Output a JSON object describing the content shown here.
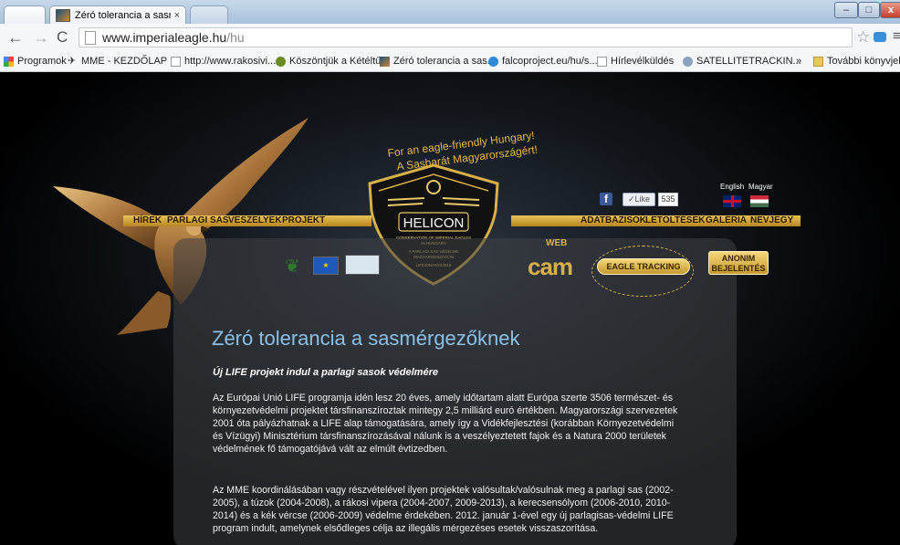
{
  "browser": {
    "tab_title": "Zéró tolerancia a sasmérg",
    "tab_close": "×",
    "url_host": "www.imperialeagle.hu",
    "url_path": "/hu",
    "window_buttons": {
      "minimize": "–",
      "maximize": "□",
      "close": "x"
    },
    "bookmarks": [
      "Programok",
      "MME - KEZDŐLAP",
      "http://www.rakosivi...",
      "Köszöntjük a Kétéltű...",
      "Zéró tolerancia a sas...",
      "falcoproject.eu/hu/s...",
      "Hírlevélküldés",
      "SATELLITETRACKIN...",
      "»",
      "További könyvjelzők"
    ]
  },
  "site": {
    "tagline_1": "For an eagle-friendly Hungary!",
    "tagline_2": "A Sasbarát Magyarországért!",
    "logo_name": "HELICON",
    "logo_line_1": "CONSERVATION OF IMPERIAL EAGLES",
    "logo_line_2": "IN HUNGARY",
    "logo_line_3": "A PARLAGI SAS VÉDELME",
    "logo_line_4": "MAGYARORSZÁGON",
    "logo_line_5": "LIFE10NAT/HU/019",
    "menu_left": [
      "HÍREK",
      "PARLAGI SAS",
      "VESZÉLYEK",
      "PROJEKT"
    ],
    "menu_right": [
      "ADATBÁZISOK",
      "LETÖLTÉSEK",
      "GALÉRIA",
      "NÉVJEGY"
    ],
    "like_label": "Like",
    "like_count": "535",
    "lang_en": "English",
    "lang_hu": "Magyar",
    "webcam_small": "WEB",
    "webcam_label": "cam",
    "tracking_label": "EAGLE TRACKING",
    "anon_line_1": "ANONIM",
    "anon_line_2": "BEJELENTÉS"
  },
  "article": {
    "title": "Zéró tolerancia a sasmérgezőknek",
    "subtitle": "Új LIFE projekt indul a parlagi sasok védelmére",
    "para_1": "Az Európai Unió LIFE programja idén lesz 20 éves, amely időtartam alatt Európa szerte 3506 természet- és környezetvédelmi projektet társfinanszíroztak mintegy 2,5 milliárd euró értékben. Magyarországi szervezetek 2001 óta pályázhatnak a LIFE alap támogatására, amely így a Vidékfejlesztési (korábban Környezetvédelmi és Vízügyi) Minisztérium társfinanszírozásával nálunk is a veszélyeztetett fajok és a Natura 2000 területek védelmének fő támogatójává vált az elmúlt évtizedben.",
    "para_2": "Az MME koordinálásában vagy részvételével ilyen projektek valósultak/valósulnak meg a parlagi sas (2002-2005), a túzok (2004-2008), a rákosi vipera (2004-2007, 2009-2013), a kerecsensólyom (2006-2010, 2010-2014) és a kék vércse (2006-2009) védelme érdekében. 2012. január 1-ével egy új parlagisas-védelmi LIFE program indult, amelynek elsődleges célja az illegális mérgezéses esetek visszaszorítása."
  }
}
